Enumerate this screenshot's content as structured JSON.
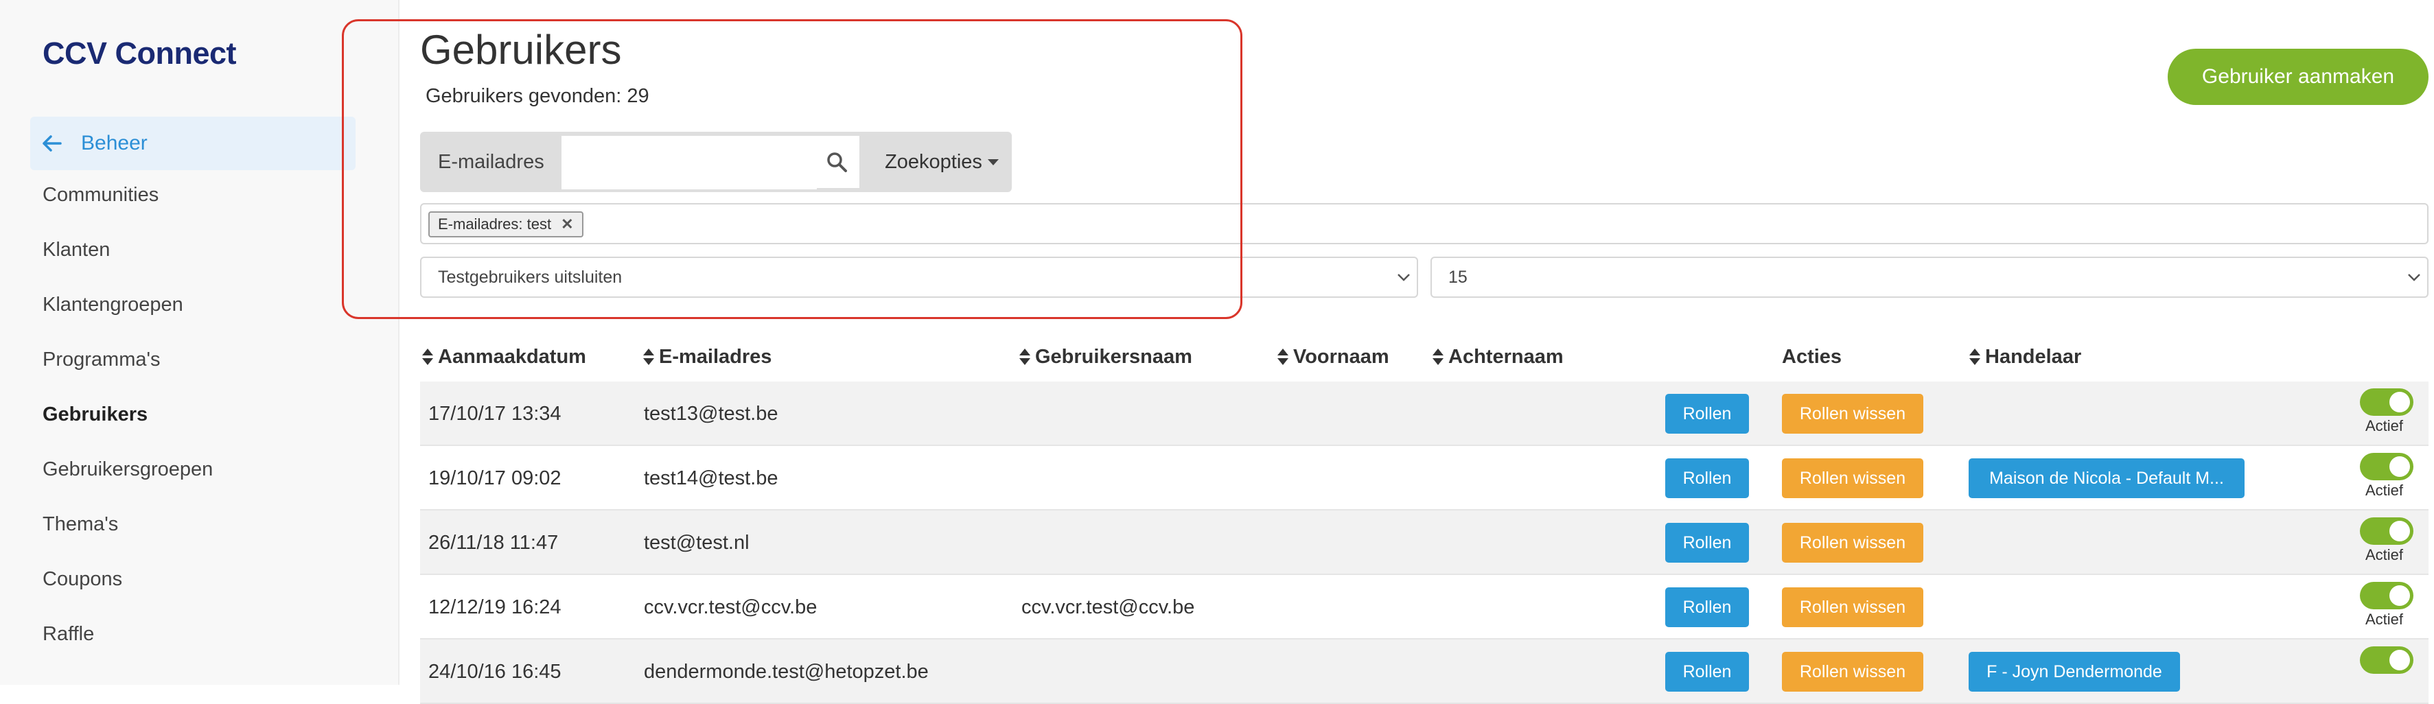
{
  "sidebar": {
    "brand": "CCV Connect",
    "back_label": "Beheer",
    "items": [
      "Communities",
      "Klanten",
      "Klantengroepen",
      "Programma's",
      "Gebruikers",
      "Gebruikersgroepen",
      "Thema's",
      "Coupons",
      "Raffle"
    ],
    "active_item": "Gebruikers"
  },
  "header": {
    "title": "Gebruikers",
    "found": "Gebruikers gevonden: 29",
    "create_button": "Gebruiker aanmaken"
  },
  "search": {
    "label": "E-mailadres",
    "value": "",
    "placeholder": "",
    "options_label": "Zoekopties"
  },
  "filters": {
    "tag": "E-mailadres: test",
    "exclude_select": "Testgebruikers uitsluiten",
    "page_size": "15"
  },
  "table": {
    "columns": [
      "Aanmaakdatum",
      "E-mailadres",
      "Gebruikersnaam",
      "Voornaam",
      "Achternaam",
      "Acties",
      "Handelaar"
    ],
    "roles_label": "Rollen",
    "clear_roles_label": "Rollen wissen",
    "active_label": "Actief",
    "rows": [
      {
        "date": "17/10/17 13:34",
        "email": "test13@test.be",
        "username": "",
        "firstname": "",
        "lastname": "",
        "merchant": "",
        "active": true
      },
      {
        "date": "19/10/17 09:02",
        "email": "test14@test.be",
        "username": "",
        "firstname": "",
        "lastname": "",
        "merchant": "Maison de Nicola - Default M...",
        "active": true
      },
      {
        "date": "26/11/18 11:47",
        "email": "test@test.nl",
        "username": "",
        "firstname": "",
        "lastname": "",
        "merchant": "",
        "active": true
      },
      {
        "date": "12/12/19 16:24",
        "email": "ccv.vcr.test@ccv.be",
        "username": "ccv.vcr.test@ccv.be",
        "firstname": "",
        "lastname": "",
        "merchant": "",
        "active": true
      },
      {
        "date": "24/10/16 16:45",
        "email": "dendermonde.test@hetopzet.be",
        "username": "",
        "firstname": "",
        "lastname": "",
        "merchant": "F - Joyn Dendermonde",
        "active": true
      }
    ]
  },
  "colors": {
    "brand": "#1a2a73",
    "primary": "#2a9ad8",
    "success": "#7fb52c",
    "warning": "#f2a634",
    "highlight": "#d9362b"
  }
}
